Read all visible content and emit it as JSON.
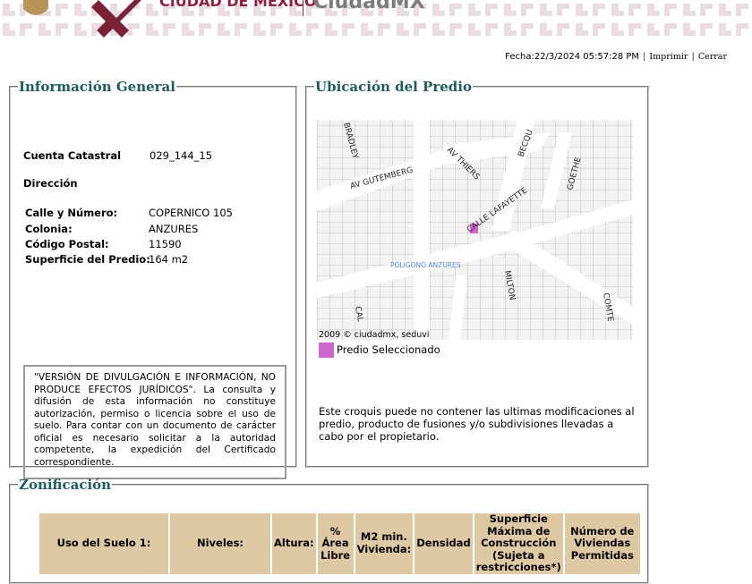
{
  "header": {
    "brand": "CIUDAD DE MÉXICO",
    "brand2": "CiudadMX"
  },
  "topbar": {
    "fecha": "Fecha:22/3/2024 05:57:28 PM",
    "imprimir": "Imprimir",
    "cerrar": "Cerrar"
  },
  "info": {
    "title": "Información General",
    "cuenta_label": "Cuenta Catastral",
    "cuenta_value": "029_144_15",
    "direccion_label": "Dirección",
    "fields": [
      {
        "label": "Calle y Número:",
        "value": "COPERNICO 105"
      },
      {
        "label": "Colonia:",
        "value": "ANZURES"
      },
      {
        "label": "Código Postal:",
        "value": "11590"
      },
      {
        "label": "Superficie del Predio:",
        "value": "164 m2"
      }
    ],
    "disclaimer": "\"VERSIÓN DE DIVULGACIÓN E INFORMACIÓN, NO PRODUCE EFECTOS JURÍDICOS\". La consulta y difusión de esta información no constituye autorización, permiso o licencia sobre el uso de suelo. Para contar con un documento de carácter oficial es necesario solicitar a la autoridad competente, la expedición del Certificado correspondiente."
  },
  "ubicacion": {
    "title": "Ubicación del Predio",
    "streets": [
      "BRADLEY",
      "AV GUTEMBERG",
      "AV THIERS",
      "BECQU",
      "GOETHE",
      "CALLE LAFAYETTE",
      "MILTON",
      "COMTE",
      "CAL"
    ],
    "area_label": "POLIGONO ANZURES",
    "copyright": "2009 © ciudadmx, seduvi",
    "legend": "Predio Seleccionado",
    "legend_color": "#cc66cc",
    "note": "Este croquis puede no contener las ultimas modificaciones al predio, producto de fusiones y/o subdivisiones llevadas a cabo por el propietario."
  },
  "zonificacion": {
    "title": "Zonificación",
    "headers": [
      "Uso del Suelo 1:",
      "Niveles:",
      "Altura:",
      "% Área Libre",
      "M2 min. Vivienda:",
      "Densidad",
      "Superficie Máxima de Construcción (Sujeta a restricciones*)",
      "Número de Viviendas Permitidas"
    ]
  }
}
